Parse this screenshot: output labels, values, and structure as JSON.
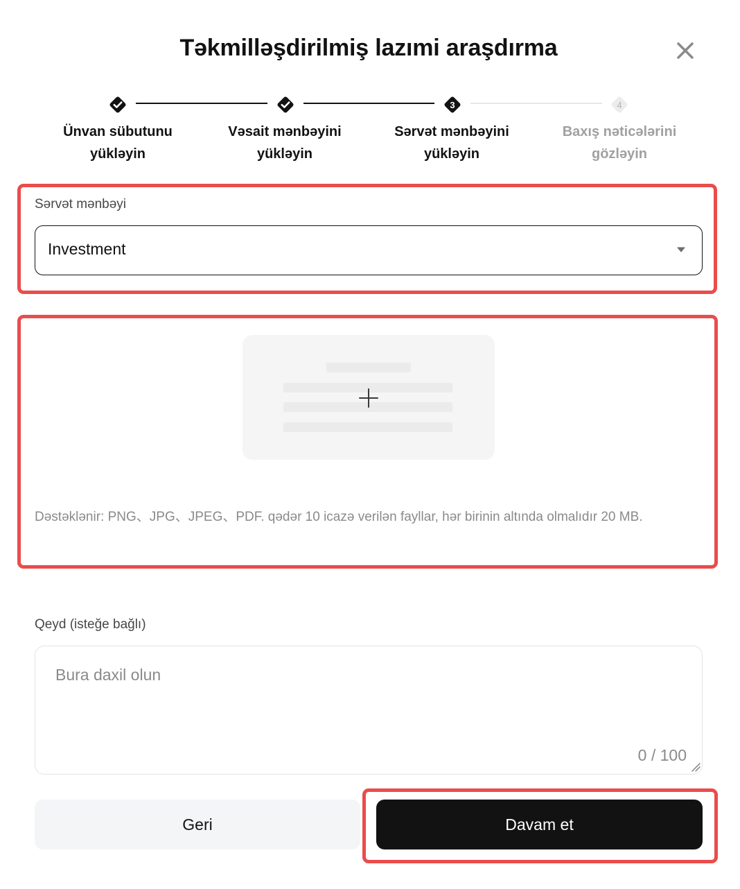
{
  "dialog": {
    "title": "Təkmilləşdirilmiş lazımi araşdırma",
    "close_icon": "close-icon"
  },
  "steps": [
    {
      "number": "1",
      "label": "Ünvan sübutunu yükləyin",
      "status": "completed"
    },
    {
      "number": "2",
      "label": "Vəsait mənbəyini yükləyin",
      "status": "completed"
    },
    {
      "number": "3",
      "label": "Sərvət mənbəyini yükləyin",
      "status": "current"
    },
    {
      "number": "4",
      "label": "Baxış nəticələrini gözləyin",
      "status": "pending"
    }
  ],
  "wealth_source": {
    "label": "Sərvət mənbəyi",
    "selected": "Investment"
  },
  "upload": {
    "hint": "Dəstəklənir: PNG、JPG、JPEG、PDF. qədər 10 icazə verilən fayllar, hər birinin altında olmalıdır 20 MB."
  },
  "note": {
    "label": "Qeyd (isteğe bağlı)",
    "placeholder": "Bura daxil olun",
    "counter": "0 / 100"
  },
  "buttons": {
    "back": "Geri",
    "continue": "Davam et"
  },
  "colors": {
    "accent": "#121212",
    "highlight": "#ea4c4c",
    "muted_text": "#8a8a8a",
    "inactive_step": "#e6e6e6"
  }
}
